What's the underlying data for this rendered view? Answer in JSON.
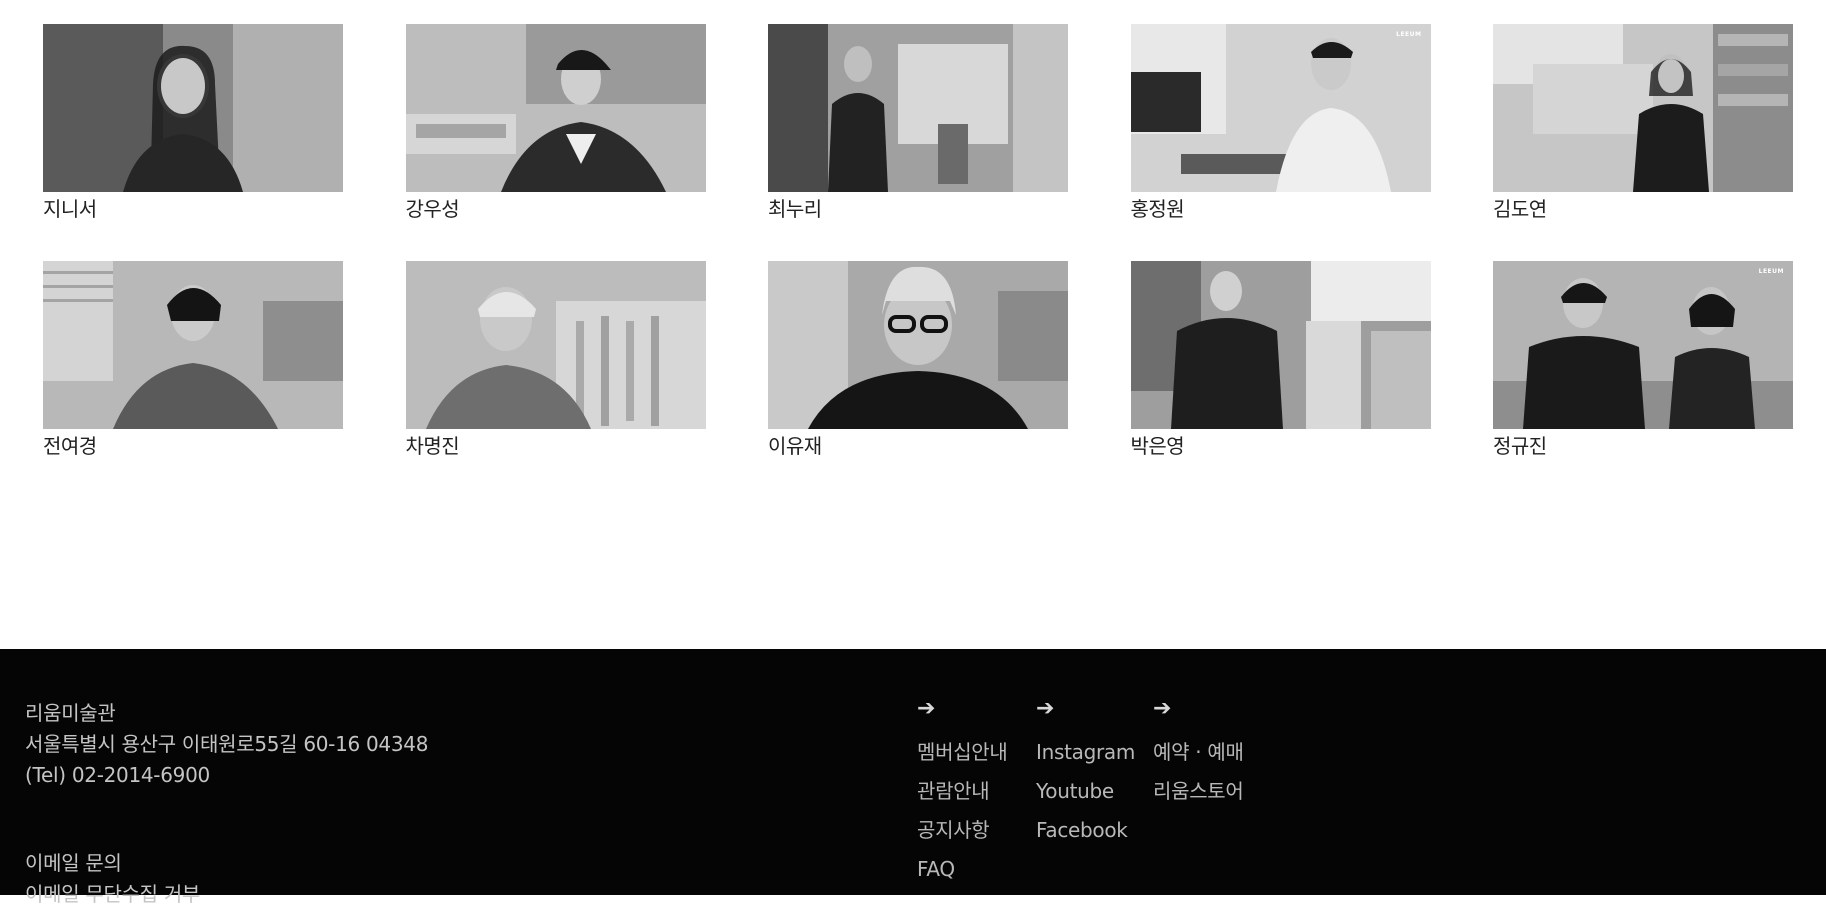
{
  "artists": [
    {
      "name": "지니서",
      "thumb_icon": "portrait-photo",
      "watermark": ""
    },
    {
      "name": "강우성",
      "thumb_icon": "portrait-photo",
      "watermark": ""
    },
    {
      "name": "최누리",
      "thumb_icon": "portrait-photo",
      "watermark": ""
    },
    {
      "name": "홍정원",
      "thumb_icon": "portrait-photo",
      "watermark": "LEEUM"
    },
    {
      "name": "김도연",
      "thumb_icon": "portrait-photo",
      "watermark": ""
    },
    {
      "name": "전여경",
      "thumb_icon": "portrait-photo",
      "watermark": ""
    },
    {
      "name": "차명진",
      "thumb_icon": "portrait-photo",
      "watermark": ""
    },
    {
      "name": "이유재",
      "thumb_icon": "portrait-photo",
      "watermark": ""
    },
    {
      "name": "박은영",
      "thumb_icon": "portrait-photo",
      "watermark": ""
    },
    {
      "name": "정규진",
      "thumb_icon": "portrait-photo",
      "watermark": "LEEUM"
    }
  ],
  "footer": {
    "museum_name": "리움미술관",
    "address": "서울특별시 용산구 이태원로55길 60-16 04348",
    "tel": "(Tel) 02-2014-6900",
    "email_inquiry": "이메일 문의",
    "email_refusal": "이메일 무단수집 거부",
    "arrow_icon": "arrow-right-icon",
    "arrow_glyph": "➔",
    "columns": [
      {
        "links": [
          "멤버십안내",
          "관람안내",
          "공지사항",
          "FAQ"
        ]
      },
      {
        "links": [
          "Instagram",
          "Youtube",
          "Facebook"
        ]
      },
      {
        "links": [
          "예약 · 예매",
          "리움스토어"
        ]
      }
    ]
  },
  "colors": {
    "page_bg": "#ffffff",
    "footer_bg": "#050505",
    "footer_text": "#c4c4c4",
    "name_text": "#222222"
  }
}
